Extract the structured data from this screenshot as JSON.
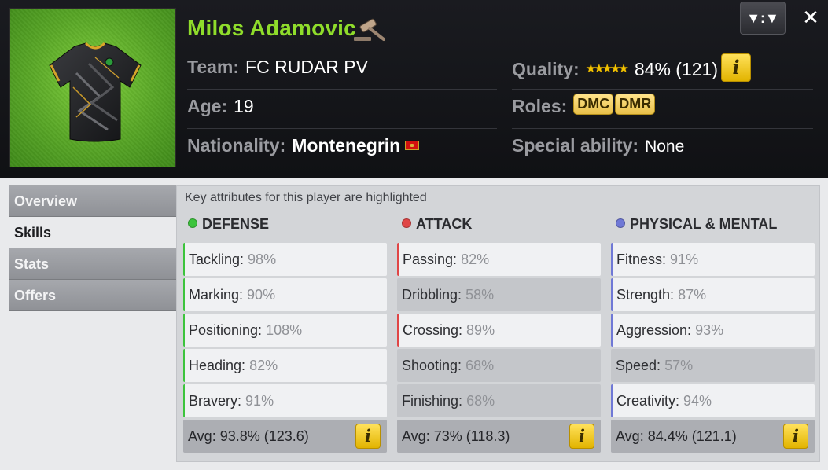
{
  "player": {
    "name": "Milos Adamovic",
    "team_label": "Team:",
    "team": "FC RUDAR PV",
    "age_label": "Age:",
    "age": "19",
    "nationality_label": "Nationality:",
    "nationality": "Montenegrin",
    "quality_label": "Quality:",
    "quality_stars": 5,
    "quality": "84% (121)",
    "roles_label": "Roles:",
    "roles": [
      "DMC",
      "DMR"
    ],
    "special_label": "Special ability:",
    "special": "None"
  },
  "toolbar": {
    "compare_label": "▼:▼",
    "close_label": "✕"
  },
  "icons": {
    "info": "i",
    "transfer": "gavel-icon",
    "flag": "montenegro-flag-icon"
  },
  "nav": {
    "items": [
      {
        "label": "Overview",
        "active": false
      },
      {
        "label": "Skills",
        "active": true
      },
      {
        "label": "Stats",
        "active": false
      },
      {
        "label": "Offers",
        "active": false
      }
    ]
  },
  "skills_panel": {
    "hint": "Key attributes for this player are highlighted",
    "columns": [
      {
        "title": "DEFENSE",
        "color": "#3cc43c",
        "skills": [
          {
            "name": "Tackling:",
            "value": "98%",
            "highlight": true
          },
          {
            "name": "Marking:",
            "value": "90%",
            "highlight": true
          },
          {
            "name": "Positioning:",
            "value": "108%",
            "highlight": true
          },
          {
            "name": "Heading:",
            "value": "82%",
            "highlight": true
          },
          {
            "name": "Bravery:",
            "value": "91%",
            "highlight": true
          }
        ],
        "avg": "Avg: 93.8% (123.6)"
      },
      {
        "title": "ATTACK",
        "color": "#e04646",
        "skills": [
          {
            "name": "Passing:",
            "value": "82%",
            "highlight": true
          },
          {
            "name": "Dribbling:",
            "value": "58%",
            "highlight": false
          },
          {
            "name": "Crossing:",
            "value": "89%",
            "highlight": true
          },
          {
            "name": "Shooting:",
            "value": "68%",
            "highlight": false
          },
          {
            "name": "Finishing:",
            "value": "68%",
            "highlight": false
          }
        ],
        "avg": "Avg: 73% (118.3)"
      },
      {
        "title": "PHYSICAL & MENTAL",
        "color": "#6f78d6",
        "skills": [
          {
            "name": "Fitness:",
            "value": "91%",
            "highlight": true
          },
          {
            "name": "Strength:",
            "value": "87%",
            "highlight": true
          },
          {
            "name": "Aggression:",
            "value": "93%",
            "highlight": true
          },
          {
            "name": "Speed:",
            "value": "57%",
            "highlight": false
          },
          {
            "name": "Creativity:",
            "value": "94%",
            "highlight": true
          }
        ],
        "avg": "Avg: 84.4% (121.1)"
      }
    ]
  }
}
